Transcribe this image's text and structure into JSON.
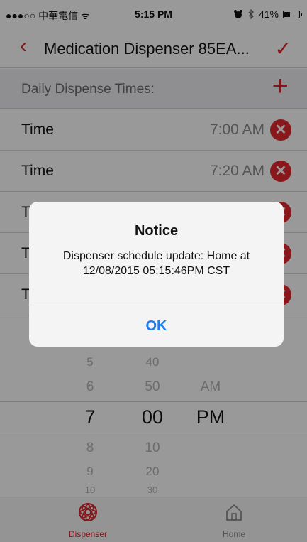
{
  "status_bar": {
    "carrier": "●●●○○ 中華電信 ᯤ",
    "time": "5:15 PM",
    "battery": "41%",
    "battery_level": 0.41,
    "alarm_icon": "alarm-icon",
    "bluetooth_icon": "bluetooth-icon"
  },
  "nav": {
    "back_icon": "‹",
    "title": "Medication Dispenser 85EA...",
    "done_icon": "✓"
  },
  "section": {
    "label": "Daily Dispense Times:",
    "add_icon": "+"
  },
  "rows": [
    {
      "label": "Time",
      "value": "7:00 AM"
    },
    {
      "label": "Time",
      "value": "7:20 AM"
    },
    {
      "label": "T",
      "value": ""
    },
    {
      "label": "T",
      "value": ""
    },
    {
      "label": "T",
      "value": ""
    }
  ],
  "delete_icon": "✕",
  "picker": {
    "hours": [
      "5",
      "6",
      "7",
      "8",
      "9",
      "10"
    ],
    "minutes": [
      "40",
      "50",
      "00",
      "10",
      "20",
      "30"
    ],
    "ampm": [
      "AM",
      "PM"
    ]
  },
  "tabs": [
    {
      "label": "Dispenser",
      "icon": "dispenser-icon",
      "active": true
    },
    {
      "label": "Home",
      "icon": "home-icon",
      "active": false
    }
  ],
  "alert": {
    "title": "Notice",
    "message": "Dispenser schedule update: Home at 12/08/2015 05:15:46PM CST",
    "button": "OK"
  },
  "colors": {
    "accent": "#d9262b",
    "link": "#1d7bf5",
    "inactive_tab": "#8e8e93"
  }
}
